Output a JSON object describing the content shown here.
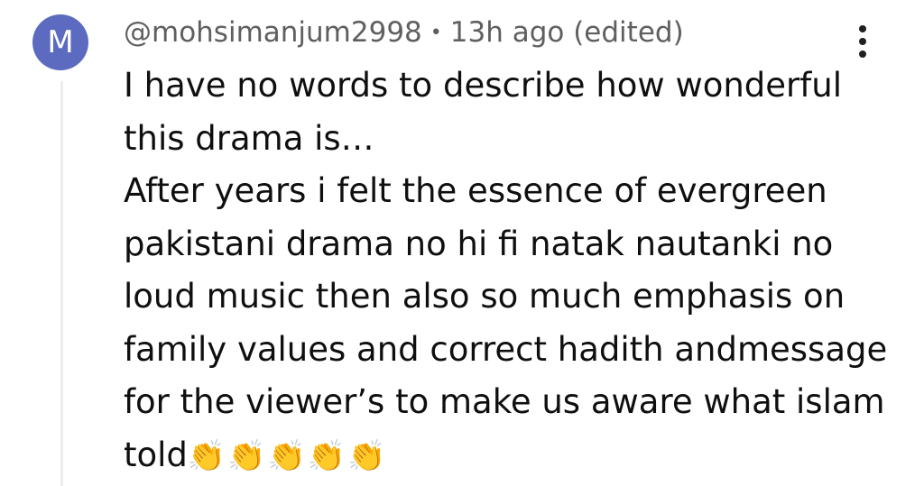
{
  "comment": {
    "avatar_letter": "M",
    "avatar_color": "#5c6bc0",
    "author": "@mohsimanjum2998",
    "separator": "•",
    "timestamp": "13h ago (edited)",
    "menu_icon": "more-vert-icon",
    "lines": [
      "I have no words to describe how wonderful",
      "this drama is…",
      "After years i felt the essence of evergreen",
      "pakistani drama no hi fi natak nautanki no",
      "loud music then also so much emphasis on",
      "family values and correct hadith andmessage",
      "for the viewer’s  to make us aware what islam",
      "told"
    ],
    "emoji": "👏👏👏👏👏"
  }
}
